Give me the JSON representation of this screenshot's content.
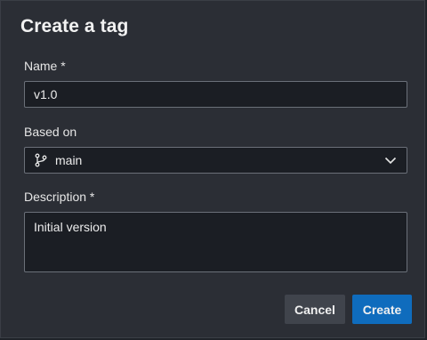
{
  "dialog": {
    "title": "Create a tag"
  },
  "form": {
    "name_label": "Name *",
    "name_value": "v1.0",
    "based_on_label": "Based on",
    "based_on_value": "main",
    "based_on_icon": "git-branch-icon",
    "description_label": "Description *",
    "description_value": "Initial version"
  },
  "actions": {
    "cancel_label": "Cancel",
    "create_label": "Create"
  },
  "colors": {
    "dialog_background": "#2b2e35",
    "field_background": "#1b1e24",
    "field_border": "#6b7079",
    "primary_button": "#0f6cbd",
    "secondary_button": "#40444c"
  }
}
